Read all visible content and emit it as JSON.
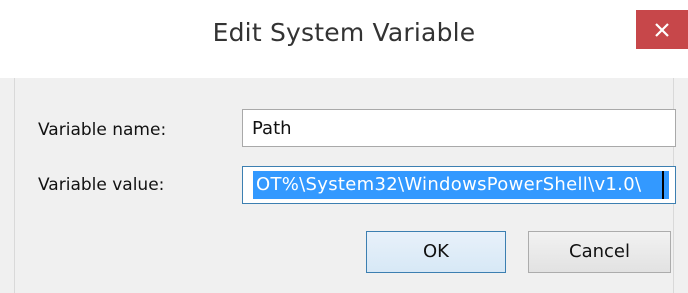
{
  "dialog": {
    "title": "Edit System Variable",
    "close_icon": "close-icon",
    "accent_close_color": "#c7474a"
  },
  "fields": {
    "name_label": "Variable name:",
    "name_value": "Path",
    "value_label": "Variable value:",
    "value_text": "OT%\\System32\\WindowsPowerShell\\v1.0\\"
  },
  "buttons": {
    "ok_label": "OK",
    "cancel_label": "Cancel"
  },
  "selection_color": "#3399ff"
}
